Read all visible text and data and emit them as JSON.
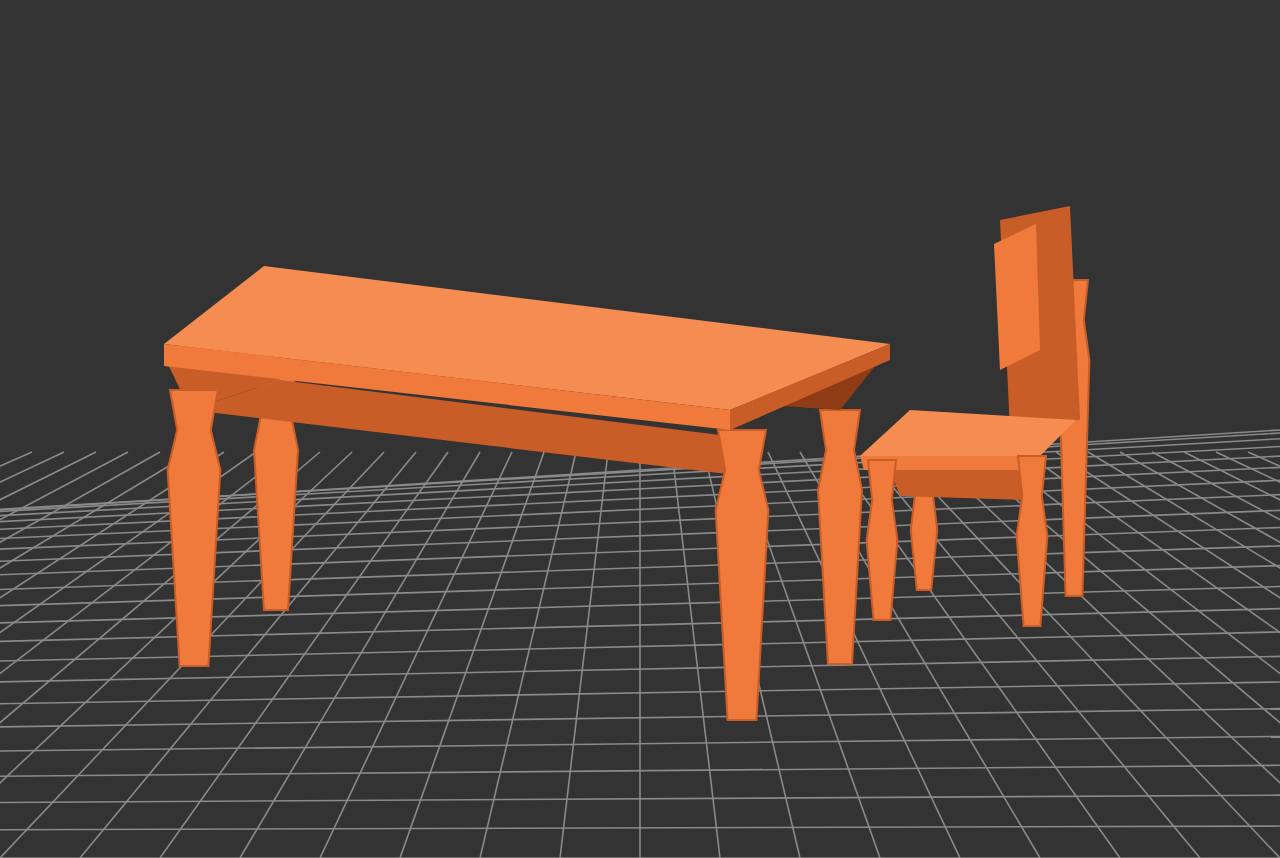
{
  "scene": {
    "grid": true,
    "objects": [
      {
        "kind": "table"
      },
      {
        "kind": "chair"
      }
    ]
  }
}
